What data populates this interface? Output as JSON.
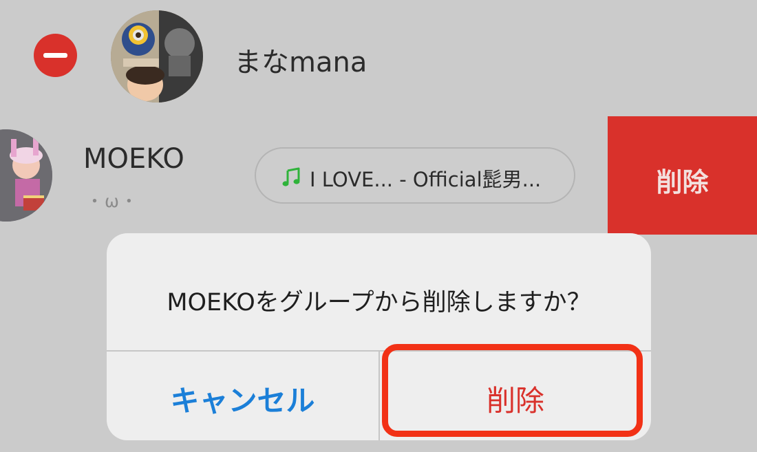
{
  "members": [
    {
      "name": "まなmana",
      "remove_icon": "minus-circle-icon",
      "avatar": "avatar-photo"
    },
    {
      "name": "MOEKO",
      "status": "・ω・",
      "avatar": "avatar-photo",
      "music": {
        "icon": "music-note-icon",
        "icon_color": "#2fb33a",
        "label": "I LOVE... - Official髭男..."
      },
      "swipe_action": "削除"
    }
  ],
  "dialog": {
    "message": "MOEKOをグループから削除しますか？",
    "cancel_label": "キャンセル",
    "confirm_label": "削除"
  },
  "colors": {
    "background": "#cbcbcb",
    "destructive": "#d9312b",
    "link_blue": "#1b7fd8",
    "highlight": "#f23116"
  }
}
